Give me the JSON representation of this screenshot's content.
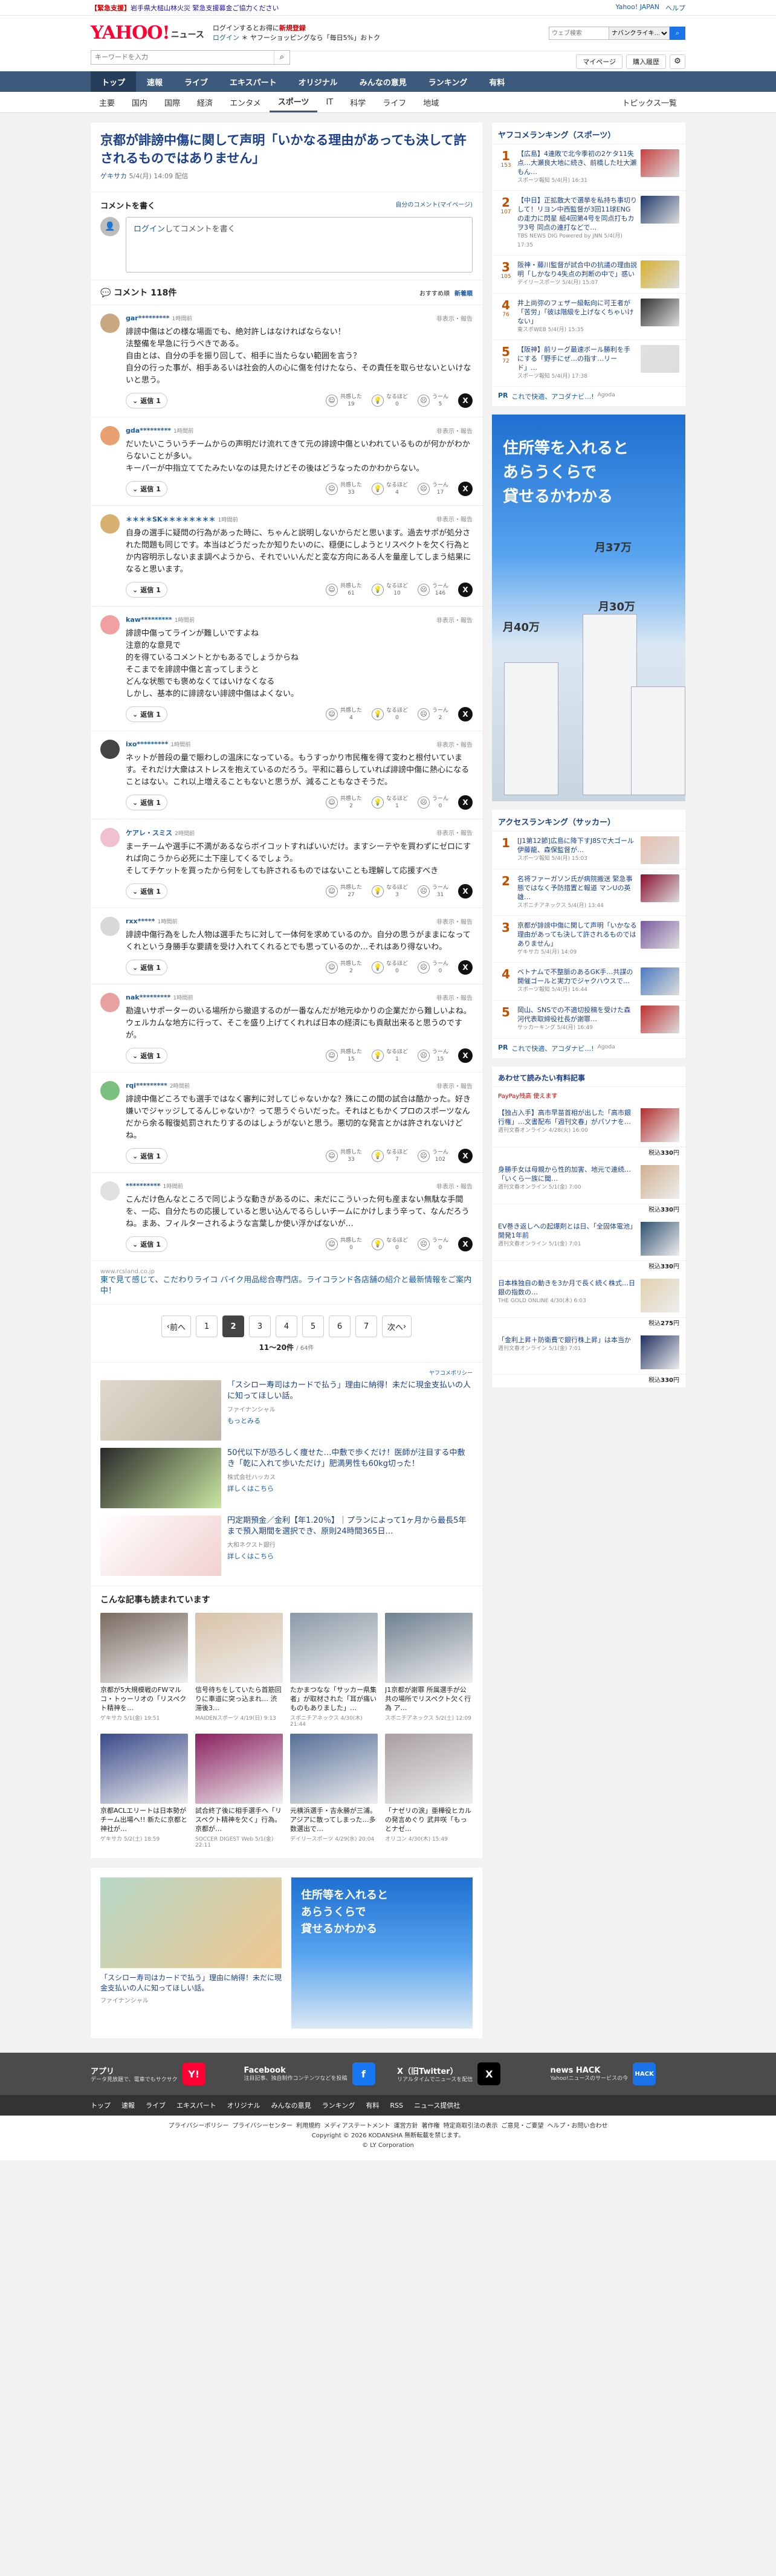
{
  "emergency": {
    "alert_label": "【緊急支援】",
    "alert_text": "岩手県大槌山林火災 緊急支援募金ご協力ください",
    "links": [
      "Yahoo! JAPAN",
      "ヘルプ"
    ]
  },
  "masthead": {
    "logo_main": "YAHOO!",
    "logo_sub": "JAPAN",
    "logo_news": "ニュース",
    "promo_line1": "ログインするとお得に",
    "promo_line1_red": "新規登録",
    "promo_line2_link": "ログイン",
    "promo_line2": "ヤフーショッピングなら「毎日5%」おトク",
    "search_placeholder": "ウェブ検索",
    "search_scope": "ナバンクライキ…"
  },
  "searchrow": {
    "placeholder": "キーワードを入力",
    "mypage": "マイページ",
    "purchase": "購入履歴"
  },
  "gnav": [
    "トップ",
    "速報",
    "ライブ",
    "エキスパート",
    "オリジナル",
    "みんなの意見",
    "ランキング",
    "有料"
  ],
  "cnav": {
    "items": [
      "主要",
      "国内",
      "国際",
      "経済",
      "エンタメ",
      "スポーツ",
      "IT",
      "科学",
      "ライフ",
      "地域"
    ],
    "active": "スポーツ",
    "topics": "トピックス一覧"
  },
  "article": {
    "title": "京都が誹謗中傷に関して声明「いかなる理由があっても決して許されるものではありません」",
    "source": "ゲキサカ",
    "date": "5/4(月) 14:09 配信"
  },
  "comment_write": {
    "heading": "コメントを書く",
    "my_link": "自分のコメント(マイページ)",
    "login": "ログイン",
    "prompt": "してコメントを書く"
  },
  "comments_head": {
    "title": "コメント",
    "count": "118件",
    "sort_rec": "おすすめ順",
    "sort_new": "新着順"
  },
  "reaction_labels": {
    "agree": "共感した",
    "think": "なるほど",
    "hmm": "うーん"
  },
  "report_label": "非表示・報告",
  "reply_label": "返信",
  "comments": [
    {
      "user": "gar*********",
      "time": "1時間前",
      "avatar": "#c7a880",
      "text": "誹謗中傷はどの様な場面でも、絶対許しはなければならない！\n法整備を早急に行うべきである。\n自由とは、自分の手を振り回して、相手に当たらない範囲を言う？\n自分の行った事が、相手あるいは社会的人の心に傷を付けたなら、その責任を取らせないといけないと思う。",
      "replies": "1",
      "agree": "19",
      "think": "0",
      "hmm": "5"
    },
    {
      "user": "gda*********",
      "time": "1時間前",
      "avatar": "#e8a070",
      "text": "だいたいこういうチームからの声明だけ流れてきて元の誹謗中傷といわれているものが何かがわからないことが多い。\nキーパーが中指立ててたみたいなのは見たけどその後はどうなったのかわからない。",
      "replies": "1",
      "agree": "33",
      "think": "4",
      "hmm": "17"
    },
    {
      "user": "＊＊＊＊SK＊＊＊＊＊＊＊＊",
      "time": "1時間前",
      "avatar": "#d8b070",
      "text": "自身の選手に疑問の行為があった時に、ちゃんと説明しないからだと思います。過去サポが処分された問題も同じです。本当はどうだったか知りたいのに、穏便にしようとリスペクトを欠く行為とか内容明示しないまま調べようから、それでいいんだと変な方向にある人を量産してしまう結果になると思います。",
      "replies": "1",
      "agree": "61",
      "think": "10",
      "hmm": "146"
    },
    {
      "user": "kaw*********",
      "time": "1時間前",
      "avatar": "#f0a0a0",
      "text": "誹謗中傷ってラインが難しいですよね\n注意的な意見で\n的を得ているコメントとかもあるでしょうからね\nそこまでを誹謗中傷と言ってしまうと\nどんな状態でも褒めなくてはいけなくなる\nしかし、基本的に誹謗ない誹謗中傷はよくない。",
      "replies": "1",
      "agree": "4",
      "think": "0",
      "hmm": "2"
    },
    {
      "user": "ixo*********",
      "time": "1時間前",
      "avatar": "#444444",
      "text": "ネットが普段の量で賑わしの温床になっている。もうすっかり市民権を得て変わと根付いています。それだけ大衆はストレスを抱えているのだろう。平和に暮らしていれば誹謗中傷に熱心になることはない。これ以上増えることもないと思うが、減ることもなさそうだ。",
      "replies": "1",
      "agree": "2",
      "think": "1",
      "hmm": "0"
    },
    {
      "user": "ケアレ・スミス",
      "time": "2時間前",
      "avatar": "#f0c0d0",
      "text": "まーチームや選手に不満があるならボイコットすればいいだけ。ますシーテやを買わずにゼロにすれば向こうから必死に土下座してくるでしょう。\nそしてチケットを買ったから何をしても許されるものではないことも理解して応援すべき",
      "replies": "1",
      "agree": "27",
      "think": "3",
      "hmm": "31"
    },
    {
      "user": "rxx*****",
      "time": "1時間前",
      "avatar": "#d8d8d8",
      "text": "誹謗中傷行為をした人物は選手たちに対して一体何を求めているのか。自分の思うがままになってくれという身勝手な要請を受け入れてくれるとでも思っているのか…それはあり得ないわ。",
      "replies": "1",
      "agree": "2",
      "think": "0",
      "hmm": "0"
    },
    {
      "user": "nak*********",
      "time": "1時間前",
      "avatar": "#e8a0a0",
      "text": "勘違いサポーターのいる場所から撤退するのが一番なんだが地元ゆかりの企業だから難しいよね。\nウェルカムな地方に行って、そこを盛り上げてくれれば日本の経済にも貢献出来ると思うのですが。",
      "replies": "1",
      "agree": "15",
      "think": "1",
      "hmm": "15"
    },
    {
      "user": "rqi*********",
      "time": "2時間前",
      "avatar": "#7cc080",
      "text": "誹謗中傷どころでも選手ではなく審判に対してじゃないかな？殊にこの間の試合は酷かった。好き嫌いでジャッジしてるんじゃないか？って思うぐらいだった。それはともかくプロのスポーツなんだから余る報復処罰されたりするのはしょうがないと思う。悪切的な発言とかは許されないけどね。",
      "replies": "1",
      "agree": "33",
      "think": "7",
      "hmm": "102"
    },
    {
      "user": "**********",
      "time": "1時間前",
      "avatar": "#e0e0e0",
      "text": "こんだけ色んなところで同じような動きがあるのに、未だにこういった何も産まない無駄な手間を、一応、自分たちの応援していると思い込んでるらしいチームにかけしまう辛って、なんだろうね。まあ、フィルターされるような言葉しか使い浮かばないが…",
      "replies": "1",
      "agree": "0",
      "think": "0",
      "hmm": "0"
    }
  ],
  "inline_pr": {
    "domain": "www.rcsland.co.jp",
    "text": "東で見て感じて、こだわりライコ バイク用品総合専門店。ライコランド各店舗の紹介と最新情報をご案内中！"
  },
  "pager": {
    "prev": "前へ",
    "pages": [
      "1",
      "2",
      "3",
      "4",
      "5",
      "6",
      "7"
    ],
    "active": "2",
    "next": "次へ",
    "range": "11〜20件",
    "total": "/ 64件"
  },
  "ad_label": "ヤフコメポリシー",
  "ads": [
    {
      "title": "「スシロー寿司はカードで払う」理由に納得！未だに現金支払いの人に知ってほしい話。",
      "sponsor": "ファイナンシャル",
      "more": "もっとみる",
      "c1": "#dfd9cc",
      "c2": "#bfb7a6"
    },
    {
      "title": "50代以下が恐ろしく痩せた…中敷で歩くだけ！医師が注目する中敷き「乾に入れて歩いただけ」肥満男性も60kg切った！",
      "sponsor": "株式会社ハッカス",
      "more": "詳しくはこちら",
      "c1": "#2a2a2a",
      "c2": "#c8e6a0"
    },
    {
      "title": "円定期預金／金利【年1.20％】｜プランによって1ヶ月から最長5年まで預入期間を選択でき、原則24時間365日…",
      "sponsor": "大和ネクスト銀行",
      "more": "詳しくはこちら",
      "c1": "#ffffff",
      "c2": "#f2d0d0"
    }
  ],
  "more_heading": "こんな記事も読まれています",
  "more_articles": [
    {
      "title": "京都が5大規模戦のFWマルコ・トゥーリオの「リスペクト精神を…",
      "source": "ゲキサカ 5/1(金) 19:51",
      "c": "#7a6a60"
    },
    {
      "title": "信号待ちをしていたら首筋回りに車道に突っ込まれ… 渋滞後3…",
      "source": "MAIDENスポーツ 4/19(日) 9:13",
      "c": "#d9c2a8"
    },
    {
      "title": "たかまつなな「サッカー県集者」が取材された「耳が痛いものもありました」…",
      "source": "スポニチアネックス 4/30(木) 21:44",
      "c": "#8b9aa8"
    },
    {
      "title": "J1京都が謝罪 所属選手が公共の場所でリスペクト欠く行為 ア…",
      "source": "スポニチアネックス 5/2(土) 12:09",
      "c": "#6f8090"
    },
    {
      "title": "京都ACLエリートは日本勢がチーム出場へ!! 新たに京都と神社が…",
      "source": "ゲキサカ 5/2(土) 18:59",
      "c": "#3a4a8a"
    },
    {
      "title": "試合終了後に相手選手へ「リスペクト精神を欠く」行為。京都が…",
      "source": "SOCCER DIGEST Web 5/1(金) 22:11",
      "c": "#8a2060"
    },
    {
      "title": "元横浜選手・吉永勝が三浦。アジアに散ってしまった…多数選出で…",
      "source": "デイリースポーツ 4/29(水) 20:04",
      "c": "#566f98"
    },
    {
      "title": "「ナゼリの涙」亜樺役ヒカルの発言めぐり 武井咲「もっとナゼ…",
      "source": "オリコン 4/30(木) 15:49",
      "c": "#a9a0a0"
    }
  ],
  "side_rank_title": "ヤフコメランキング（スポーツ）",
  "side_rank": [
    {
      "no": "1",
      "cnt": "153",
      "title": "【広島】4連敗で北今季初の2ケタ11失点…大瀬良大地に続き、前橋した吐大瀬もん…",
      "src": "スポーツ報知 5/4(月) 16:31",
      "c": "#c84040"
    },
    {
      "title": "【中日】正拡散大で選挙を私持ち事切りして！リヨン中西監督が3回11球ENGの走力に閃星 組4回第4号を同点打もカヲ3号 同点の連打などで…",
      "no": "2",
      "cnt": "107",
      "src": "TBS NEWS DIG Powered by JNN 5/4(月) 17:35",
      "c": "#203a6a"
    },
    {
      "no": "3",
      "cnt": "105",
      "title": "阪神・藤川監督が試合中の抗議の理由説明「しかなり4失点の判断の中で」惑い",
      "src": "デイリースポーツ 5/4(月) 15:07",
      "c": "#d8b030"
    },
    {
      "no": "4",
      "cnt": "76",
      "title": "井上尚弥のフェザー級転向に可王者が「苦労」「彼は階級を上げなくちゃいけない」",
      "src": "東スポWEB 5/4(月) 15:35",
      "c": "#303030"
    },
    {
      "no": "5",
      "cnt": "72",
      "title": "【阪神】前リーグ最速ボール勝利を手にする「野手にぜ…の指す…リード」…",
      "src": "スポーツ報知 5/4(月) 17:38",
      "c": "#e0e0e0"
    }
  ],
  "side_pr": "これで快適、アコダナビ…!",
  "side_pr_src": "Agoda",
  "rect_ad": {
    "text": "住所等を入れると\nあらうくらで\n貸せるかわかる",
    "price1": "月37万",
    "price2": "月30万",
    "price3": "月40万"
  },
  "side_rank2_title": "アクセスランキング（サッカー）",
  "side_rank2": [
    {
      "no": "1",
      "title": "[J1第12節]広島に降下すJ8Sで大ゴール伊藤龍、森保監督が…",
      "src": "スポーツ報知 5/4(月) 15:03",
      "c": "#e8c0b0"
    },
    {
      "no": "2",
      "title": "名将ファーガソン氏が病院搬送 緊急事態ではなく予防措置と報道 マンUの英雄…",
      "src": "スポニチアネックス 5/4(月) 13:44",
      "c": "#8a1030"
    },
    {
      "no": "3",
      "title": "京都が誹謗中傷に関して声明「いかなる理由があっても決して許されるものではありません」",
      "src": "ゲキサカ 5/4(月) 14:09",
      "c": "#7a5aa0"
    },
    {
      "no": "4",
      "title": "ベトナムで不整脈のあるGK手…共謀の開催ゴールと実力でジャクハウスで… ",
      "src": "スポーツ報知 5/4(月) 16:44",
      "c": "#4a7ac0"
    },
    {
      "no": "5",
      "title": "岡山、SNSでの不適切投稿を受けた森河代表取締役社長が謝罪…",
      "src": "サッカーキング 5/4(月) 16:49",
      "c": "#c03030"
    }
  ],
  "side_pr2": "これで快適、アコダナビ…!",
  "side_pr2_src": "Agoda",
  "side_shop_title": "あわせて読みたい有料記事",
  "side_shop_sub": "PayPay残高 使えます",
  "side_shop": [
    {
      "title": "【独占入手】高市早苗首相が出した「高市銀行権」…文書配布「週刊文春」がパソナを…",
      "src": "週刊文春オンライン 4/28(火) 16:00",
      "price": "330",
      "c": "#b03030"
    },
    {
      "title": "身勝手女は母親から性的加害、地元で連続…「いくら一族に聞…",
      "src": "週刊文春オンライン 5/1(金) 7:00",
      "price": "330",
      "c": "#d0b090"
    },
    {
      "title": "EV巻き返しへの起爆剤とは日、「全固体電池」開発1年前",
      "src": "週刊文春オンライン 5/1(金) 7:01",
      "price": "330",
      "c": "#305070"
    },
    {
      "title": "日本株独自の動きを3か月で長く続く株式…日銀の指数の…",
      "src": "THE GOLD ONLINE 4/30(木) 6:03",
      "price": "275",
      "c": "#e0d0b0"
    },
    {
      "title": "「金利上昇＋防衛費で銀行株上昇」は本当か",
      "src": "週刊文春オンライン 5/1(金) 7:01",
      "price": "330",
      "c": "#203060"
    }
  ],
  "footer": {
    "apps": [
      {
        "name": "アプリ",
        "desc": "データ見放題で、電車でもサクサク",
        "icon": "Y!"
      },
      {
        "name": "Facebook",
        "desc": "注目記事、独自制作コンテンツなどを投稿",
        "icon": "f"
      },
      {
        "name": "X（旧Twitter）",
        "desc": "リアルタイムでニュースを配信",
        "icon": "X"
      },
      {
        "name": "news HACK",
        "desc": "Yahoo!ニュースのサービスの今",
        "icon": "HACK"
      }
    ],
    "nav": [
      "トップ",
      "速報",
      "ライブ",
      "エキスパート",
      "オリジナル",
      "みんなの意見",
      "ランキング",
      "有料",
      "RSS",
      "ニュース提供社"
    ],
    "legal": [
      "プライバシーポリシー",
      "プライバシーセンター",
      "利用規約",
      "メディアステートメント",
      "運営方針",
      "著作権",
      "特定商取引法の表示",
      "ご意見・ご要望",
      "ヘルプ・お問い合わせ"
    ],
    "copyright": "Copyright © 2026 KODANSHA 無断転載を禁じます。",
    "copyright2": "© LY Corporation"
  }
}
